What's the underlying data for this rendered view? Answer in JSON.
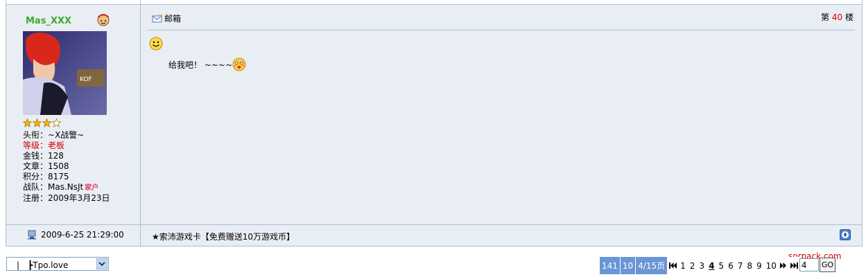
{
  "post": {
    "username": "Mas_XXX",
    "info": {
      "title_label": "头衔：",
      "title_value": "~X战警~",
      "level_label": "等级：",
      "level_value": "老板",
      "money_label": "金钱：",
      "money_value": "128",
      "articles_label": "文章：",
      "articles_value": "1508",
      "points_label": "积分：",
      "points_value": "8175",
      "team_label": "战队：",
      "team_value": "Mas.NsJt",
      "team_badge": "家户",
      "register_label": "注册：",
      "register_value": "2009年3月23日"
    },
    "stars": {
      "filled": 3,
      "total": 4
    },
    "mail_label": "邮箱",
    "floor_prefix": "第",
    "floor_number": "40",
    "floor_suffix": "楼",
    "message_text": "给我吧！ ~~~~",
    "post_time": "2009-6-25 21:29:00",
    "ad_text": "★索沛游戏卡【免费赠送10万游戏币】"
  },
  "bottom": {
    "select_value": "|　┣Tpo.love",
    "pager": {
      "total": "141",
      "per_page": "10",
      "page_info": "4/15页",
      "pages": [
        "1",
        "2",
        "3",
        "4",
        "5",
        "6",
        "7",
        "8",
        "9",
        "10"
      ],
      "current": "4",
      "input_value": "4",
      "go_label": "GO"
    },
    "watermark": "sorpack.com"
  },
  "colors": {
    "username": "#3aab2c",
    "accent_red": "#d40000",
    "border": "#a9bfd6",
    "panel_bg": "#e9eef4",
    "pager_bg": "#6a95d6"
  }
}
